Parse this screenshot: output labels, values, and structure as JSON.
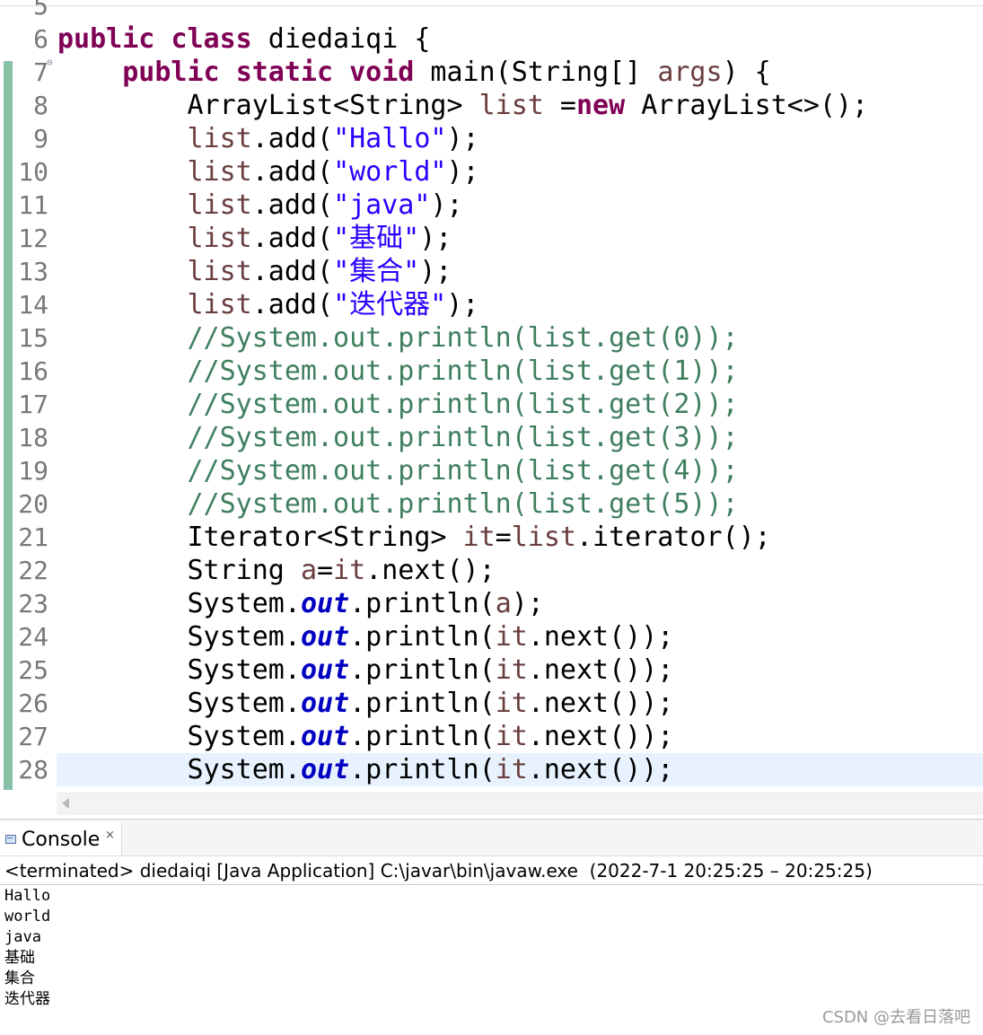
{
  "editor": {
    "current_line": "28",
    "lines": [
      {
        "num": "5",
        "tokens": []
      },
      {
        "num": "6",
        "tokens": [
          [
            "kw",
            "public"
          ],
          [
            "p",
            " "
          ],
          [
            "kw",
            "class"
          ],
          [
            "p",
            " diedaiqi {"
          ]
        ]
      },
      {
        "num": "7",
        "fold": true,
        "tokens": [
          [
            "p",
            "    "
          ],
          [
            "kw",
            "public"
          ],
          [
            "p",
            " "
          ],
          [
            "kw",
            "static"
          ],
          [
            "p",
            " "
          ],
          [
            "kw",
            "void"
          ],
          [
            "p",
            " main(String[] "
          ],
          [
            "var",
            "args"
          ],
          [
            "p",
            ") {"
          ]
        ]
      },
      {
        "num": "8",
        "tokens": [
          [
            "p",
            "        ArrayList<String> "
          ],
          [
            "var",
            "list"
          ],
          [
            "p",
            " ="
          ],
          [
            "kw",
            "new"
          ],
          [
            "p",
            " ArrayList<>();"
          ]
        ]
      },
      {
        "num": "9",
        "tokens": [
          [
            "p",
            "        "
          ],
          [
            "var",
            "list"
          ],
          [
            "p",
            ".add("
          ],
          [
            "str",
            "\"Hallo\""
          ],
          [
            "p",
            ");"
          ]
        ]
      },
      {
        "num": "10",
        "tokens": [
          [
            "p",
            "        "
          ],
          [
            "var",
            "list"
          ],
          [
            "p",
            ".add("
          ],
          [
            "str",
            "\"world\""
          ],
          [
            "p",
            ");"
          ]
        ]
      },
      {
        "num": "11",
        "tokens": [
          [
            "p",
            "        "
          ],
          [
            "var",
            "list"
          ],
          [
            "p",
            ".add("
          ],
          [
            "str",
            "\"java\""
          ],
          [
            "p",
            ");"
          ]
        ]
      },
      {
        "num": "12",
        "tokens": [
          [
            "p",
            "        "
          ],
          [
            "var",
            "list"
          ],
          [
            "p",
            ".add("
          ],
          [
            "str",
            "\"基础\""
          ],
          [
            "p",
            ");"
          ]
        ]
      },
      {
        "num": "13",
        "tokens": [
          [
            "p",
            "        "
          ],
          [
            "var",
            "list"
          ],
          [
            "p",
            ".add("
          ],
          [
            "str",
            "\"集合\""
          ],
          [
            "p",
            ");"
          ]
        ]
      },
      {
        "num": "14",
        "tokens": [
          [
            "p",
            "        "
          ],
          [
            "var",
            "list"
          ],
          [
            "p",
            ".add("
          ],
          [
            "str",
            "\"迭代器\""
          ],
          [
            "p",
            ");"
          ]
        ]
      },
      {
        "num": "15",
        "tokens": [
          [
            "p",
            "        "
          ],
          [
            "com",
            "//System.out.println(list.get(0));"
          ]
        ]
      },
      {
        "num": "16",
        "tokens": [
          [
            "p",
            "        "
          ],
          [
            "com",
            "//System.out.println(list.get(1));"
          ]
        ]
      },
      {
        "num": "17",
        "tokens": [
          [
            "p",
            "        "
          ],
          [
            "com",
            "//System.out.println(list.get(2));"
          ]
        ]
      },
      {
        "num": "18",
        "tokens": [
          [
            "p",
            "        "
          ],
          [
            "com",
            "//System.out.println(list.get(3));"
          ]
        ]
      },
      {
        "num": "19",
        "tokens": [
          [
            "p",
            "        "
          ],
          [
            "com",
            "//System.out.println(list.get(4));"
          ]
        ]
      },
      {
        "num": "20",
        "tokens": [
          [
            "p",
            "        "
          ],
          [
            "com",
            "//System.out.println(list.get(5));"
          ]
        ]
      },
      {
        "num": "21",
        "tokens": [
          [
            "p",
            "        Iterator<String> "
          ],
          [
            "var",
            "it"
          ],
          [
            "p",
            "="
          ],
          [
            "var",
            "list"
          ],
          [
            "p",
            ".iterator();"
          ]
        ]
      },
      {
        "num": "22",
        "tokens": [
          [
            "p",
            "        String "
          ],
          [
            "var",
            "a"
          ],
          [
            "p",
            "="
          ],
          [
            "var",
            "it"
          ],
          [
            "p",
            ".next();"
          ]
        ]
      },
      {
        "num": "23",
        "tokens": [
          [
            "p",
            "        System."
          ],
          [
            "static",
            "out"
          ],
          [
            "p",
            ".println("
          ],
          [
            "var",
            "a"
          ],
          [
            "p",
            ");"
          ]
        ]
      },
      {
        "num": "24",
        "tokens": [
          [
            "p",
            "        System."
          ],
          [
            "static",
            "out"
          ],
          [
            "p",
            ".println("
          ],
          [
            "var",
            "it"
          ],
          [
            "p",
            ".next());"
          ]
        ]
      },
      {
        "num": "25",
        "tokens": [
          [
            "p",
            "        System."
          ],
          [
            "static",
            "out"
          ],
          [
            "p",
            ".println("
          ],
          [
            "var",
            "it"
          ],
          [
            "p",
            ".next());"
          ]
        ]
      },
      {
        "num": "26",
        "tokens": [
          [
            "p",
            "        System."
          ],
          [
            "static",
            "out"
          ],
          [
            "p",
            ".println("
          ],
          [
            "var",
            "it"
          ],
          [
            "p",
            ".next());"
          ]
        ]
      },
      {
        "num": "27",
        "tokens": [
          [
            "p",
            "        System."
          ],
          [
            "static",
            "out"
          ],
          [
            "p",
            ".println("
          ],
          [
            "var",
            "it"
          ],
          [
            "p",
            ".next());"
          ]
        ]
      },
      {
        "num": "28",
        "tokens": [
          [
            "p",
            "        System."
          ],
          [
            "static",
            "out"
          ],
          [
            "p",
            ".println("
          ],
          [
            "var",
            "it"
          ],
          [
            "p",
            ".next());"
          ]
        ]
      }
    ]
  },
  "console": {
    "tab_label": "Console",
    "close_glyph": "×",
    "status": "<terminated> diedaiqi [Java Application] C:\\javar\\bin\\javaw.exe  (2022-7-1 20:25:25 – 20:25:25)",
    "output": [
      "Hallo",
      "world",
      "java",
      "基础",
      "集合",
      "迭代器"
    ]
  },
  "watermark": "CSDN @去看日落吧"
}
